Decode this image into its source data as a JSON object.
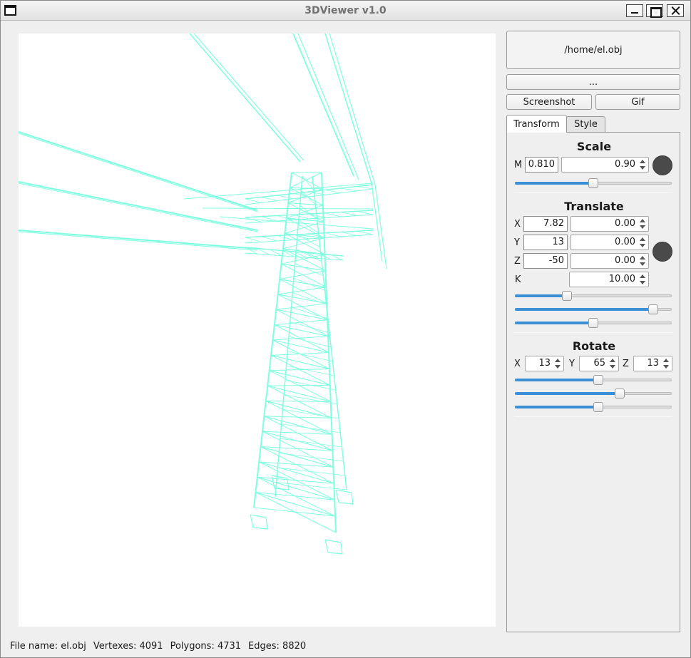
{
  "window": {
    "title": "3DViewer v1.0"
  },
  "file": {
    "path": "/home/el.obj",
    "browse_label": "..."
  },
  "actions": {
    "screenshot_label": "Screenshot",
    "gif_label": "Gif"
  },
  "tabs": [
    {
      "label": "Transform",
      "active": true
    },
    {
      "label": "Style",
      "active": false
    }
  ],
  "scale": {
    "title": "Scale",
    "m_label": "M",
    "m_value": "0.810",
    "spin_value": "0.90",
    "slider": 0.5
  },
  "translate": {
    "title": "Translate",
    "x_label": "X",
    "x_value": "7.82",
    "x_spin": "0.00",
    "y_label": "Y",
    "y_value": "13",
    "y_spin": "0.00",
    "z_label": "Z",
    "z_value": "-50",
    "z_spin": "0.00",
    "k_label": "K",
    "k_spin": "10.00",
    "sliders": [
      0.33,
      0.88,
      0.5
    ]
  },
  "rotate": {
    "title": "Rotate",
    "x_label": "X",
    "x_value": "13",
    "y_label": "Y",
    "y_value": "65",
    "z_label": "Z",
    "z_value": "13",
    "sliders": [
      0.53,
      0.67,
      0.53
    ]
  },
  "status": {
    "file_name": "File name: el.obj",
    "vertexes": "Vertexes: 4091",
    "polygons": "Polygons: 4731",
    "edges": "Edges: 8820"
  },
  "colors": {
    "model_line": "#7fffe0",
    "accent": "#3b8fd4",
    "dot": "#4a4a4a"
  }
}
